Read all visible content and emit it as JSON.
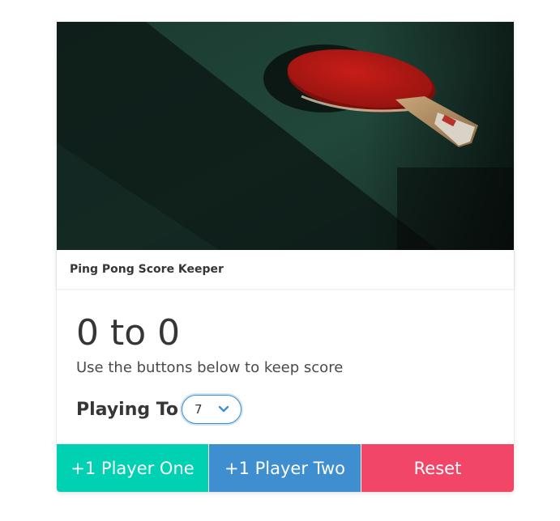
{
  "card": {
    "title": "Ping Pong Score Keeper"
  },
  "score": {
    "text": "0 to 0",
    "subtitle": "Use the buttons below to keep score"
  },
  "playing_to": {
    "label": "Playing To",
    "selected_value": "7",
    "chevron_icon": "chevron-down-icon"
  },
  "buttons": {
    "player_one": "+1 Player One",
    "player_two": "+1 Player Two",
    "reset": "Reset"
  },
  "colors": {
    "player_one": "#00d1b2",
    "player_two": "#3e8ed0",
    "reset": "#f14668"
  }
}
